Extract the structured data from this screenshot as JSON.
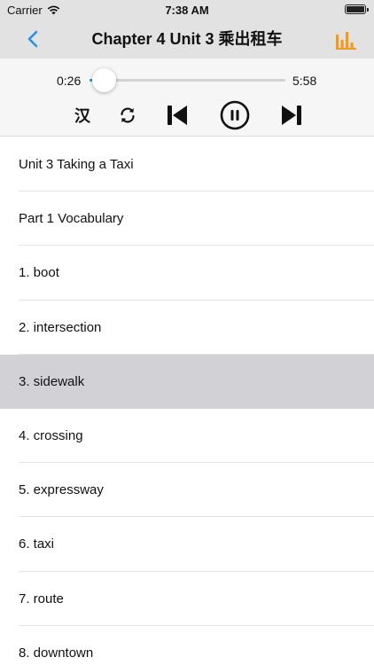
{
  "status_bar": {
    "carrier": "Carrier",
    "time": "7:38 AM"
  },
  "nav": {
    "title": "Chapter 4 Unit 3 乘出租车",
    "back_icon": "chevron-left-icon",
    "equalizer_icon": "equalizer-icon"
  },
  "player": {
    "current_time": "0:26",
    "total_time": "5:58",
    "progress": 0.073,
    "controls": {
      "language_toggle": "汉",
      "repeat_icon": "repeat-icon",
      "previous_icon": "skip-previous-icon",
      "pause_icon": "pause-icon",
      "next_icon": "skip-next-icon"
    }
  },
  "list": {
    "selected_index": 4,
    "items": [
      "Unit 3 Taking a Taxi",
      "Part 1 Vocabulary",
      "1. boot",
      "2. intersection",
      "3. sidewalk",
      "4. crossing",
      "5. expressway",
      "6. taxi",
      "7. route",
      "8. downtown"
    ]
  },
  "colors": {
    "accent_blue": "#2e8fe6",
    "eq_orange": "#f39a1e",
    "nav_bg": "#e2e2e2",
    "player_bg": "#f6f6f6",
    "selected_row": "#d2d2d6"
  }
}
